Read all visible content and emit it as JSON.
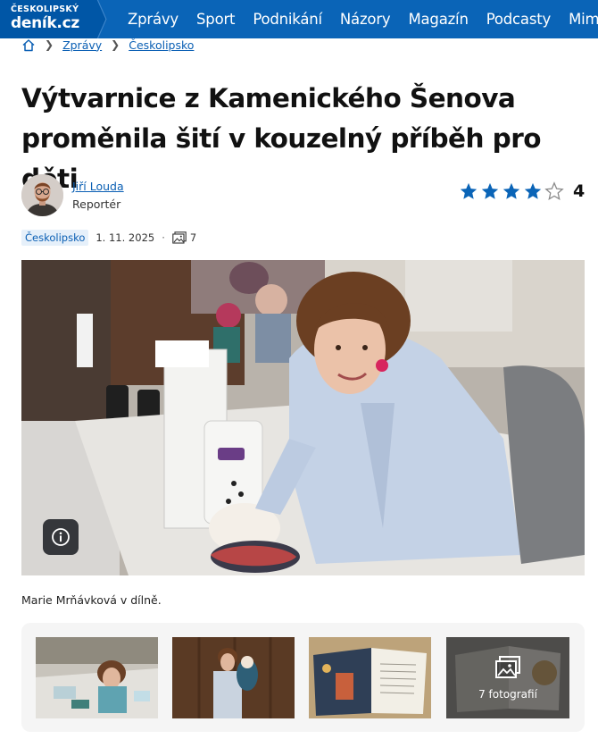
{
  "site": {
    "logo_top": "ČESKOLIPSKÝ",
    "logo_bottom": "deník.cz"
  },
  "nav": [
    "Zprávy",
    "Sport",
    "Podnikání",
    "Názory",
    "Magazín",
    "Podcasty",
    "Miminka"
  ],
  "breadcrumb": {
    "items": [
      "Zprávy",
      "Českolipsko"
    ]
  },
  "article": {
    "title_line1": "Výtvarnice z Kamenického Šenova",
    "title_line2": "proměnila šití v kouzelný příběh pro děti",
    "author_name": "Jiří Louda",
    "author_role": "Reportér",
    "rating": "4",
    "rating_fraction": 0.8,
    "tag": "Českolipsko",
    "date": "1. 11. 2025",
    "photo_count": "7",
    "caption": "Marie Mrňávková v dílně."
  },
  "gallery": {
    "more_label": "7  fotografií"
  },
  "colors": {
    "brand": "#0a64b7",
    "star": "#0a64b7",
    "link": "#0a5fb4"
  }
}
